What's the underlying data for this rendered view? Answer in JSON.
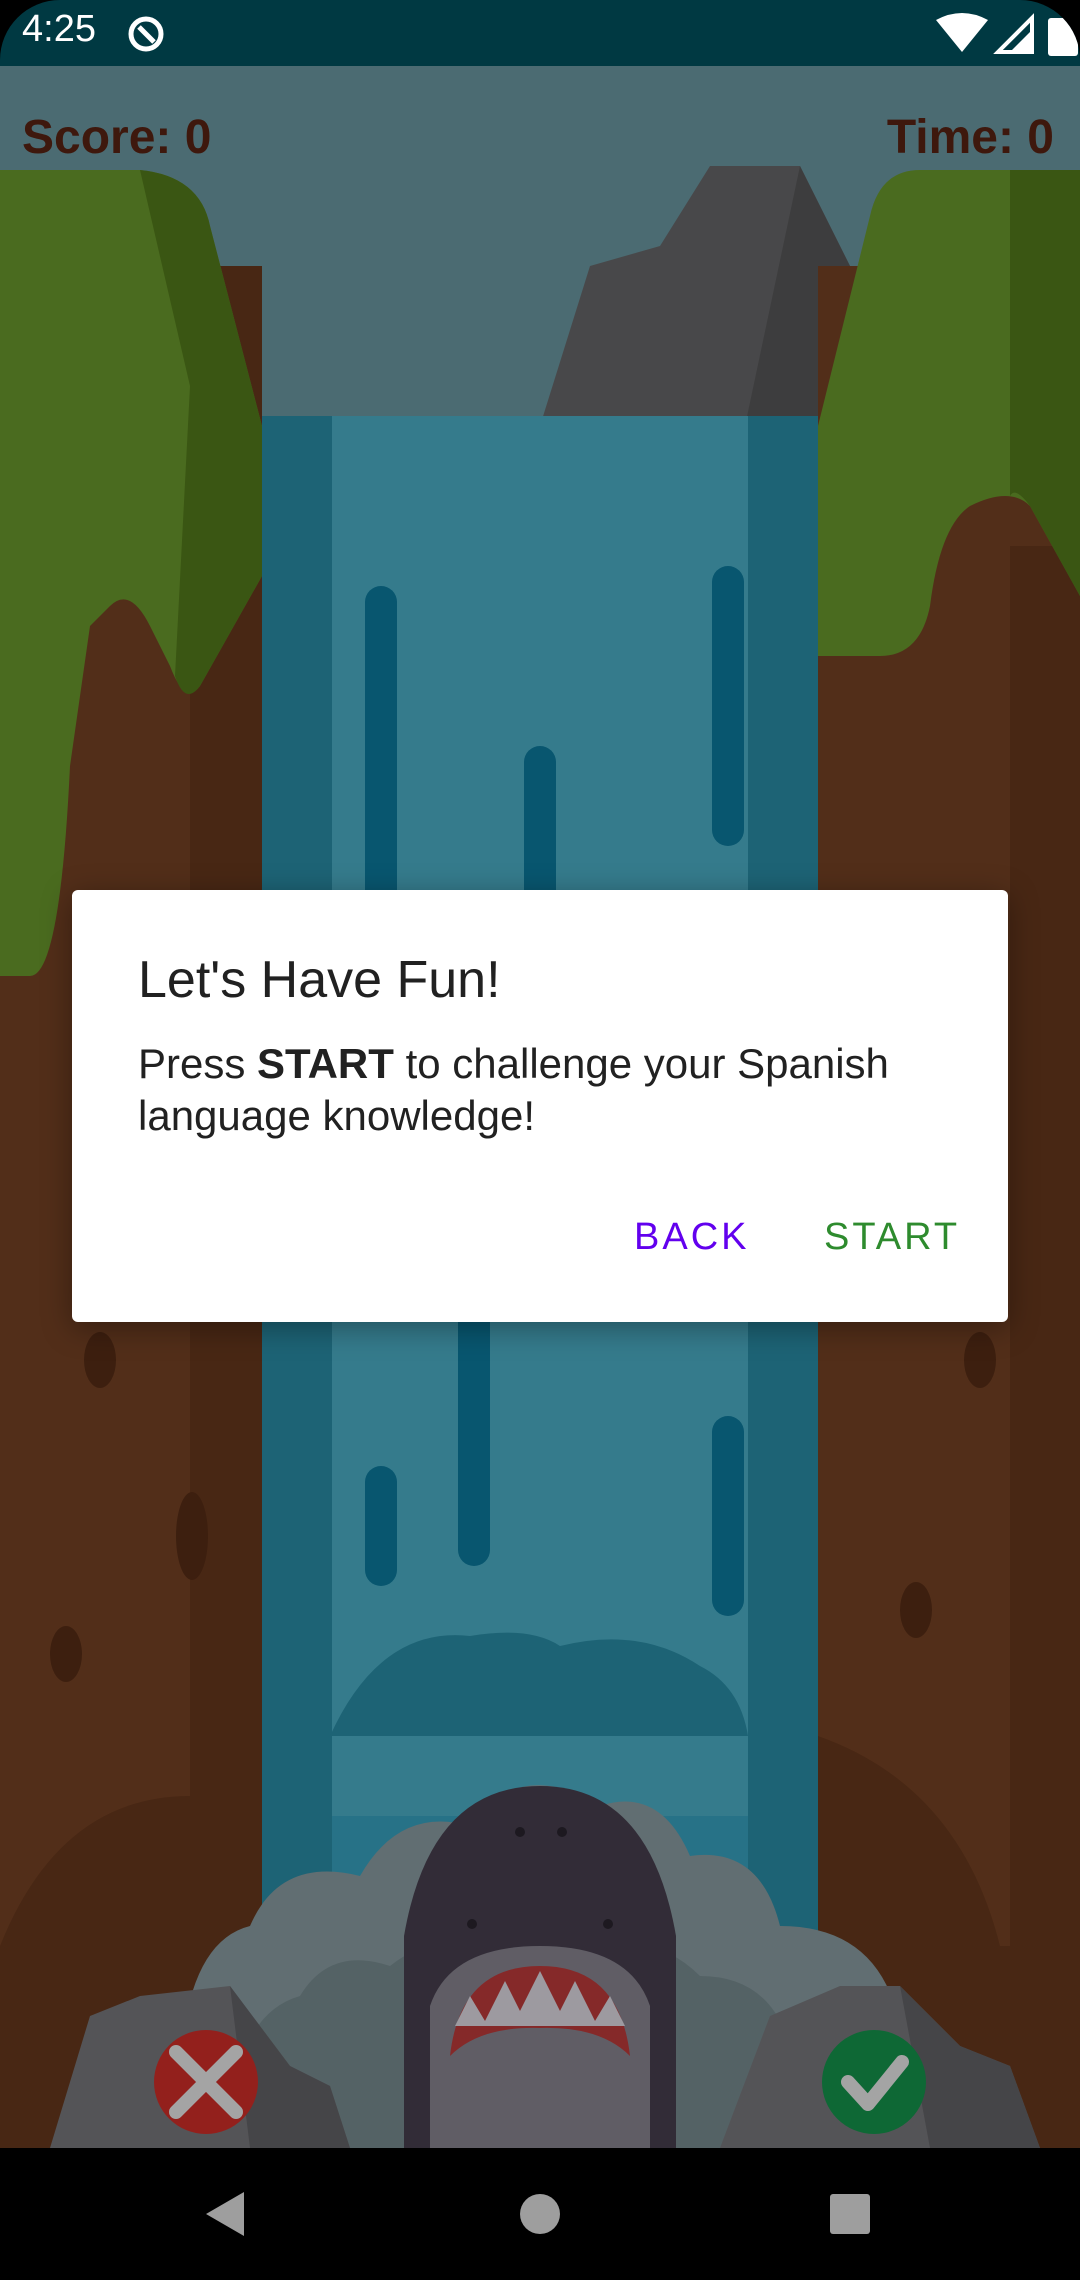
{
  "status_bar": {
    "time": "4:25",
    "icons": [
      "app-notification-icon",
      "wifi-icon",
      "cell-signal-icon",
      "battery-icon"
    ]
  },
  "hud": {
    "score_label": "Score: 0",
    "time_label": "Time: 0"
  },
  "dialog": {
    "title": "Let's Have Fun!",
    "message_prefix": "Press ",
    "message_bold": "START",
    "message_suffix": " to challenge your Spanish language knowledge!",
    "back_label": "BACK",
    "start_label": "START"
  },
  "game_buttons": {
    "wrong_icon": "x-icon",
    "correct_icon": "check-icon"
  },
  "colors": {
    "status_bar": "#003942",
    "sky": "#6f9ea8",
    "waterfall": "#3aa9c7",
    "cliff": "#7a4526",
    "grass": "#6e9e2e",
    "back_button": "#6200ee",
    "start_button": "#2e8b2e",
    "wrong_button": "#d9302a",
    "correct_button": "#159a4f"
  },
  "nav_bar": {
    "back": "nav-back-icon",
    "home": "nav-home-icon",
    "recents": "nav-recents-icon"
  }
}
